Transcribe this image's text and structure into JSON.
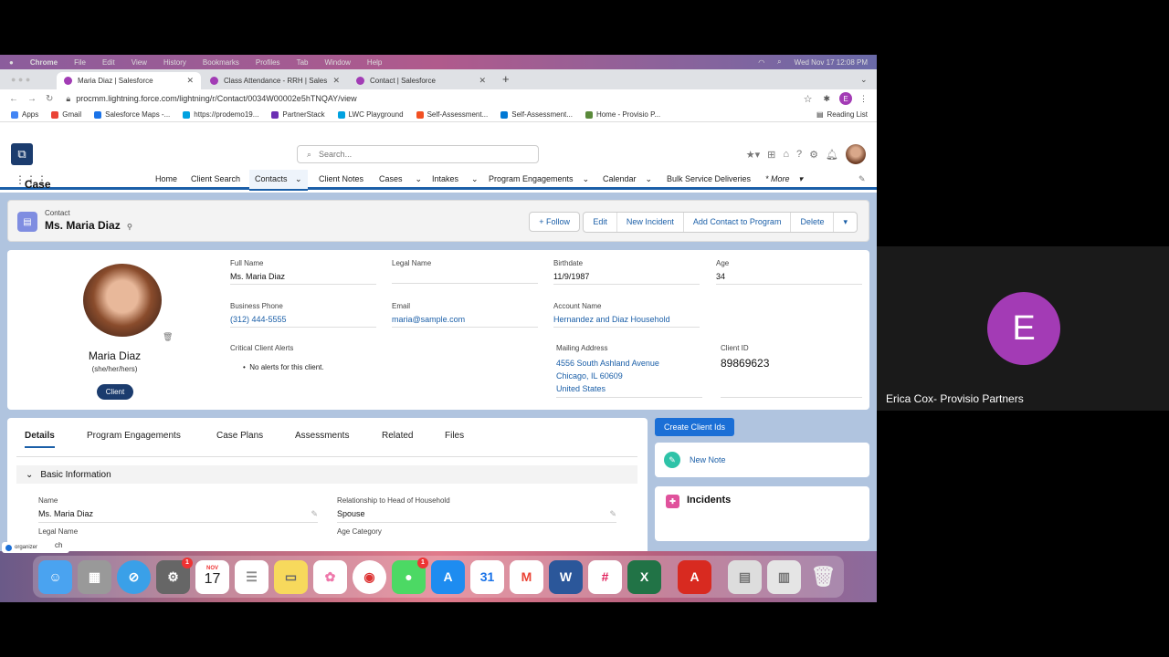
{
  "mac_menu": {
    "app": "Chrome",
    "items": [
      "File",
      "Edit",
      "View",
      "History",
      "Bookmarks",
      "Profiles",
      "Tab",
      "Window",
      "Help"
    ],
    "clock": "Wed Nov 17  12:08 PM"
  },
  "browser": {
    "tabs": [
      {
        "label": "Maria Diaz | Salesforce",
        "active": true
      },
      {
        "label": "Class Attendance - RRH | Sales",
        "active": false
      },
      {
        "label": "Contact | Salesforce",
        "active": false
      }
    ],
    "new_tab": "+",
    "url": "procmm.lightning.force.com/lightning/r/Contact/0034W00002e5hTNQAY/view",
    "profile_initial": "E",
    "bookmarks": [
      "Apps",
      "Gmail",
      "Salesforce Maps -...",
      "https://prodemo19...",
      "PartnerStack",
      "LWC Playground",
      "Self-Assessment...",
      "Self-Assessment...",
      "Home - Provisio P..."
    ],
    "reading_list": "Reading List"
  },
  "sf": {
    "search_placeholder": "Search...",
    "app_name": "Case Management",
    "nav": [
      "Home",
      "Client Search",
      "Contacts",
      "Client Notes",
      "Cases",
      "Intakes",
      "Program Engagements",
      "Calendar",
      "Bulk Service Deliveries",
      "More"
    ],
    "record": {
      "type": "Contact",
      "name": "Ms. Maria Diaz",
      "buttons": [
        "Edit",
        "New Incident",
        "Add Contact to Program",
        "Delete"
      ],
      "follow": "Follow"
    },
    "profile": {
      "name": "Maria Diaz",
      "pronouns": "(she/her/hers)",
      "badge": "Client"
    },
    "fields": {
      "full_name_label": "Full Name",
      "full_name": "Ms. Maria Diaz",
      "legal_name_label": "Legal Name",
      "legal_name": "",
      "birthdate_label": "Birthdate",
      "birthdate": "11/9/1987",
      "age_label": "Age",
      "age": "34",
      "phone_label": "Business Phone",
      "phone": "(312) 444-5555",
      "email_label": "Email",
      "email": "maria@sample.com",
      "account_label": "Account Name",
      "account": "Hernandez and Diaz Household",
      "alerts_label": "Critical Client Alerts",
      "alerts": "No alerts for this client.",
      "address_label": "Mailing Address",
      "address_line1": "4556 South Ashland Avenue",
      "address_line2": "Chicago, IL 60609",
      "address_line3": "United States",
      "client_id_label": "Client ID",
      "client_id": "89869623"
    },
    "detail_tabs": [
      "Details",
      "Program Engagements",
      "Case Plans",
      "Assessments",
      "Related",
      "Files"
    ],
    "section": "Basic Information",
    "basic": {
      "name_label": "Name",
      "name": "Ms. Maria Diaz",
      "rel_label": "Relationship to Head of Household",
      "rel": "Spouse",
      "legal_label": "Legal Name",
      "age_cat_label": "Age Category"
    },
    "right": {
      "create_ids": "Create Client Ids",
      "new_note": "New Note",
      "incidents": "Incidents"
    }
  },
  "dock": {
    "organizer": "organizer",
    "search_frag": "ch",
    "calendar_month": "NOV",
    "calendar_day": "17",
    "apps": [
      "finder",
      "launchpad",
      "safari",
      "system-preferences",
      "calendar",
      "reminders",
      "notes",
      "photos",
      "chrome",
      "messages",
      "app-store",
      "google-calendar",
      "gmail",
      "word",
      "slack",
      "excel",
      "acrobat",
      "files",
      "trash"
    ]
  },
  "video": {
    "initial": "E",
    "name": "Erica Cox- Provisio Partners"
  }
}
